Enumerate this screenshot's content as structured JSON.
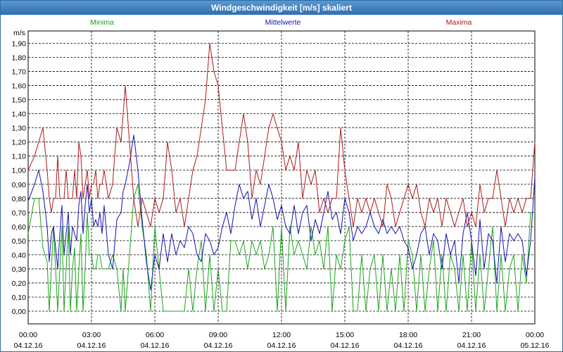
{
  "chart_data": {
    "type": "line",
    "title": "Windgeschwindigkeit [m/s] skaliert",
    "ylabel": "m/s",
    "ylim": [
      0,
      1.9
    ],
    "yticks": [
      "0,00",
      "0,10",
      "0,20",
      "0,30",
      "0,40",
      "0,50",
      "0,60",
      "0,70",
      "0,80",
      "0,90",
      "1,00",
      "1,10",
      "1,20",
      "1,30",
      "1,40",
      "1,50",
      "1,60",
      "1,70",
      "1,80",
      "1,90"
    ],
    "xlim_hours": [
      0,
      24
    ],
    "xticks": [
      {
        "time": "00:00",
        "date": "04.12.16"
      },
      {
        "time": "03:00",
        "date": "04.12.16"
      },
      {
        "time": "06:00",
        "date": "04.12.16"
      },
      {
        "time": "09:00",
        "date": "04.12.16"
      },
      {
        "time": "12:00",
        "date": "04.12.16"
      },
      {
        "time": "15:00",
        "date": "04.12.16"
      },
      {
        "time": "18:00",
        "date": "04.12.16"
      },
      {
        "time": "21:00",
        "date": "04.12.16"
      },
      {
        "time": "00:00",
        "date": "05.12.16"
      }
    ],
    "grid": true,
    "series": [
      {
        "name": "Minima",
        "color": "#1aa51a",
        "x": [
          0,
          0.3,
          0.5,
          0.7,
          0.9,
          1.0,
          1.1,
          1.2,
          1.3,
          1.4,
          1.5,
          1.6,
          1.7,
          1.8,
          1.9,
          2.0,
          2.1,
          2.2,
          2.3,
          2.4,
          2.5,
          2.6,
          2.7,
          2.8,
          2.9,
          3.0,
          3.1,
          3.2,
          3.3,
          3.4,
          3.5,
          3.6,
          3.8,
          4.0,
          4.2,
          4.4,
          4.5,
          4.6,
          4.8,
          5.0,
          5.2,
          5.4,
          5.6,
          5.8,
          6.0,
          6.2,
          6.4,
          6.6,
          6.8,
          7.0,
          7.2,
          7.4,
          7.6,
          7.8,
          8.0,
          8.2,
          8.4,
          8.6,
          8.8,
          9.0,
          9.2,
          9.4,
          9.6,
          9.8,
          10.0,
          10.2,
          10.4,
          10.6,
          10.8,
          11.0,
          11.2,
          11.4,
          11.6,
          11.8,
          12.0,
          12.2,
          12.4,
          12.6,
          12.8,
          13.0,
          13.2,
          13.4,
          13.6,
          13.8,
          14.0,
          14.2,
          14.4,
          14.6,
          14.8,
          15.0,
          15.2,
          15.4,
          15.6,
          15.8,
          16.0,
          16.2,
          16.4,
          16.6,
          16.8,
          17.0,
          17.2,
          17.4,
          17.6,
          17.8,
          18.0,
          18.2,
          18.4,
          18.6,
          18.8,
          19.0,
          19.2,
          19.4,
          19.6,
          19.8,
          20.0,
          20.2,
          20.4,
          20.6,
          20.8,
          21.0,
          21.2,
          21.4,
          21.6,
          21.8,
          22.0,
          22.2,
          22.4,
          22.6,
          22.8,
          23.0,
          23.2,
          23.4,
          23.6,
          23.8,
          24.0
        ],
        "values": [
          0.55,
          0.8,
          0.8,
          0.45,
          0.35,
          0.0,
          0.3,
          0.6,
          0.3,
          0.0,
          0.3,
          0.6,
          0.0,
          0.3,
          0.6,
          0.0,
          0.3,
          0.45,
          0.0,
          0.3,
          0.55,
          0.0,
          0.3,
          0.7,
          0.4,
          0.4,
          0.3,
          0.3,
          0.4,
          0.4,
          0.3,
          0.3,
          0.3,
          0.4,
          0.3,
          0.0,
          0.3,
          0.0,
          0.4,
          0.8,
          0.9,
          0.6,
          0.4,
          0.0,
          0.6,
          0.3,
          0.0,
          0.0,
          0.0,
          0.0,
          0.0,
          0.0,
          0.3,
          0.0,
          0.3,
          0.5,
          0.0,
          0.4,
          0.0,
          0.3,
          0.0,
          0.0,
          0.5,
          0.5,
          0.4,
          0.5,
          0.3,
          0.5,
          0.4,
          0.5,
          0.3,
          0.4,
          0.6,
          0.0,
          0.6,
          0.0,
          0.6,
          0.4,
          0.5,
          0.4,
          0.3,
          0.6,
          0.4,
          0.5,
          0.3,
          0.6,
          0.0,
          0.4,
          0.3,
          0.5,
          0.6,
          0.0,
          0.0,
          0.4,
          0.0,
          0.3,
          0.4,
          0.0,
          0.4,
          0.0,
          0.3,
          0.0,
          0.4,
          0.0,
          0.5,
          0.4,
          0.0,
          0.4,
          0.0,
          0.3,
          0.5,
          0.0,
          0.4,
          0.0,
          0.4,
          0.3,
          0.0,
          0.4,
          0.0,
          0.5,
          0.0,
          0.4,
          0.0,
          0.3,
          0.6,
          0.0,
          0.4,
          0.0,
          0.3,
          0.4,
          0.0,
          0.4,
          0.2,
          0.7,
          0.7
        ]
      },
      {
        "name": "Mittelwerte",
        "color": "#1212b0",
        "x": [
          0,
          0.3,
          0.5,
          0.7,
          0.9,
          1.0,
          1.1,
          1.2,
          1.3,
          1.4,
          1.5,
          1.6,
          1.7,
          1.8,
          1.9,
          2.0,
          2.1,
          2.2,
          2.3,
          2.4,
          2.5,
          2.6,
          2.7,
          2.8,
          2.9,
          3.0,
          3.1,
          3.2,
          3.3,
          3.4,
          3.5,
          3.6,
          3.8,
          4.0,
          4.2,
          4.4,
          4.5,
          4.6,
          4.8,
          5.0,
          5.2,
          5.4,
          5.6,
          5.8,
          6.0,
          6.2,
          6.4,
          6.6,
          6.8,
          7.0,
          7.2,
          7.4,
          7.6,
          7.8,
          8.0,
          8.2,
          8.4,
          8.6,
          8.8,
          9.0,
          9.2,
          9.4,
          9.6,
          9.8,
          10.0,
          10.2,
          10.4,
          10.6,
          10.8,
          11.0,
          11.2,
          11.4,
          11.6,
          11.8,
          12.0,
          12.2,
          12.4,
          12.6,
          12.8,
          13.0,
          13.2,
          13.4,
          13.6,
          13.8,
          14.0,
          14.2,
          14.4,
          14.6,
          14.8,
          15.0,
          15.2,
          15.4,
          15.6,
          15.8,
          16.0,
          16.2,
          16.4,
          16.6,
          16.8,
          17.0,
          17.2,
          17.4,
          17.6,
          17.8,
          18.0,
          18.2,
          18.4,
          18.6,
          18.8,
          19.0,
          19.2,
          19.4,
          19.6,
          19.8,
          20.0,
          20.2,
          20.4,
          20.6,
          20.8,
          21.0,
          21.2,
          21.4,
          21.6,
          21.8,
          22.0,
          22.2,
          22.4,
          22.6,
          22.8,
          23.0,
          23.2,
          23.4,
          23.6,
          23.8,
          24.0
        ],
        "values": [
          0.78,
          0.9,
          1.0,
          0.85,
          0.6,
          0.35,
          0.55,
          0.6,
          0.45,
          0.3,
          0.55,
          0.75,
          0.4,
          0.55,
          0.7,
          0.4,
          0.6,
          0.55,
          0.5,
          0.75,
          0.85,
          0.55,
          0.75,
          0.9,
          0.7,
          0.8,
          0.6,
          0.65,
          0.6,
          0.7,
          0.55,
          0.75,
          0.4,
          0.3,
          0.65,
          0.7,
          0.85,
          0.9,
          1.05,
          1.25,
          1.0,
          0.65,
          0.35,
          0.15,
          0.4,
          0.3,
          0.55,
          0.35,
          0.55,
          0.4,
          0.5,
          0.45,
          0.6,
          0.55,
          0.4,
          0.35,
          0.55,
          0.5,
          0.4,
          0.45,
          0.6,
          0.7,
          0.55,
          0.75,
          0.9,
          0.8,
          0.85,
          0.65,
          0.8,
          0.6,
          0.75,
          0.9,
          0.8,
          0.65,
          0.75,
          0.6,
          0.55,
          0.75,
          0.55,
          0.7,
          0.75,
          0.5,
          0.65,
          0.55,
          0.7,
          0.85,
          0.65,
          0.7,
          0.55,
          0.8,
          0.7,
          0.5,
          0.6,
          0.55,
          0.6,
          0.7,
          0.6,
          0.55,
          0.65,
          0.55,
          0.6,
          0.55,
          0.6,
          0.5,
          0.45,
          0.3,
          0.4,
          0.55,
          0.6,
          0.4,
          0.55,
          0.5,
          0.3,
          0.55,
          0.4,
          0.5,
          0.2,
          0.55,
          0.7,
          0.5,
          0.25,
          0.65,
          0.3,
          0.55,
          0.5,
          0.2,
          0.6,
          0.35,
          0.55,
          0.5,
          0.55,
          0.5,
          0.25,
          0.5,
          0.95
        ]
      },
      {
        "name": "Maxima",
        "color": "#b01a1a",
        "x": [
          0,
          0.3,
          0.5,
          0.7,
          0.9,
          1.0,
          1.1,
          1.2,
          1.3,
          1.4,
          1.5,
          1.6,
          1.7,
          1.8,
          1.9,
          2.0,
          2.1,
          2.2,
          2.3,
          2.4,
          2.5,
          2.6,
          2.7,
          2.8,
          2.9,
          3.0,
          3.1,
          3.2,
          3.3,
          3.4,
          3.5,
          3.6,
          3.8,
          4.0,
          4.2,
          4.4,
          4.5,
          4.6,
          4.8,
          5.0,
          5.2,
          5.4,
          5.6,
          5.8,
          6.0,
          6.2,
          6.4,
          6.6,
          6.8,
          7.0,
          7.2,
          7.4,
          7.6,
          7.8,
          8.0,
          8.2,
          8.4,
          8.6,
          8.8,
          9.0,
          9.2,
          9.4,
          9.6,
          9.8,
          10.0,
          10.2,
          10.4,
          10.6,
          10.8,
          11.0,
          11.2,
          11.4,
          11.6,
          11.8,
          12.0,
          12.2,
          12.4,
          12.6,
          12.8,
          13.0,
          13.2,
          13.4,
          13.6,
          13.8,
          14.0,
          14.2,
          14.4,
          14.6,
          14.8,
          15.0,
          15.2,
          15.4,
          15.6,
          15.8,
          16.0,
          16.2,
          16.4,
          16.6,
          16.8,
          17.0,
          17.2,
          17.4,
          17.6,
          17.8,
          18.0,
          18.2,
          18.4,
          18.6,
          18.8,
          19.0,
          19.2,
          19.4,
          19.6,
          19.8,
          20.0,
          20.2,
          20.4,
          20.6,
          20.8,
          21.0,
          21.2,
          21.4,
          21.6,
          21.8,
          22.0,
          22.2,
          22.4,
          22.6,
          22.8,
          23.0,
          23.2,
          23.4,
          23.6,
          23.8,
          24.0
        ],
        "values": [
          1.0,
          1.1,
          1.2,
          1.3,
          1.0,
          0.8,
          0.7,
          0.8,
          0.8,
          1.1,
          0.8,
          0.8,
          0.8,
          1.0,
          0.8,
          0.8,
          0.8,
          1.0,
          0.8,
          1.2,
          1.1,
          0.8,
          0.9,
          1.0,
          0.8,
          0.9,
          0.9,
          1.0,
          0.8,
          0.9,
          0.9,
          1.0,
          0.8,
          0.9,
          1.3,
          1.2,
          1.4,
          1.6,
          1.2,
          0.8,
          0.6,
          0.8,
          0.7,
          0.6,
          0.8,
          0.7,
          0.8,
          1.2,
          1.0,
          0.7,
          0.8,
          0.6,
          0.8,
          1.0,
          1.1,
          1.3,
          1.5,
          1.9,
          1.7,
          1.6,
          1.3,
          1.0,
          1.0,
          1.0,
          1.2,
          1.4,
          1.2,
          0.8,
          1.0,
          0.9,
          1.1,
          1.3,
          1.4,
          1.3,
          1.2,
          1.0,
          1.1,
          1.0,
          1.2,
          0.8,
          1.0,
          0.9,
          1.0,
          0.7,
          0.8,
          0.7,
          0.8,
          0.8,
          1.3,
          1.0,
          0.8,
          0.6,
          0.8,
          0.7,
          0.8,
          0.7,
          0.8,
          0.7,
          0.6,
          0.9,
          0.8,
          0.6,
          0.7,
          0.8,
          0.9,
          0.8,
          0.9,
          0.7,
          0.6,
          0.8,
          0.7,
          0.8,
          0.6,
          0.8,
          0.7,
          0.6,
          0.7,
          0.8,
          0.6,
          0.7,
          0.6,
          0.9,
          0.7,
          0.8,
          0.8,
          1.0,
          0.8,
          0.6,
          0.8,
          0.7,
          0.8,
          0.7,
          0.8,
          0.8,
          1.2
        ]
      }
    ]
  }
}
